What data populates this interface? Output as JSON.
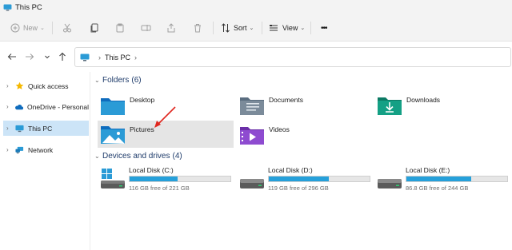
{
  "window": {
    "title": "This PC"
  },
  "toolbar": {
    "new_label": "New",
    "sort_label": "Sort",
    "view_label": "View",
    "more_label": "•••"
  },
  "address": {
    "crumb": "This PC"
  },
  "sidebar": {
    "items": [
      {
        "label": "Quick access",
        "icon": "star-icon"
      },
      {
        "label": "OneDrive - Personal",
        "icon": "cloud-icon"
      },
      {
        "label": "This PC",
        "icon": "computer-icon",
        "selected": true
      },
      {
        "label": "Network",
        "icon": "network-icon"
      }
    ]
  },
  "folders": {
    "title": "Folders",
    "count": "(6)",
    "items": [
      {
        "name": "Desktop",
        "icon": "desktop-folder-icon"
      },
      {
        "name": "Documents",
        "icon": "documents-folder-icon"
      },
      {
        "name": "Downloads",
        "icon": "downloads-folder-icon"
      },
      {
        "name": "Pictures",
        "icon": "pictures-folder-icon",
        "hovered": true
      },
      {
        "name": "Videos",
        "icon": "videos-folder-icon"
      }
    ]
  },
  "drives": {
    "title": "Devices and drives",
    "count": "(4)",
    "items": [
      {
        "name": "Local Disk (C:)",
        "free": "116 GB free of 221 GB",
        "used_fraction": 0.475
      },
      {
        "name": "Local Disk (D:)",
        "free": "119 GB free of 296 GB",
        "used_fraction": 0.598
      },
      {
        "name": "Local Disk (E:)",
        "free": "86.8 GB free of 244 GB",
        "used_fraction": 0.644
      }
    ]
  },
  "colors": {
    "accent": "#26a0da",
    "selection": "#cce4f7",
    "hover": "#e5e5e5",
    "annotation_arrow": "#e0261e"
  }
}
